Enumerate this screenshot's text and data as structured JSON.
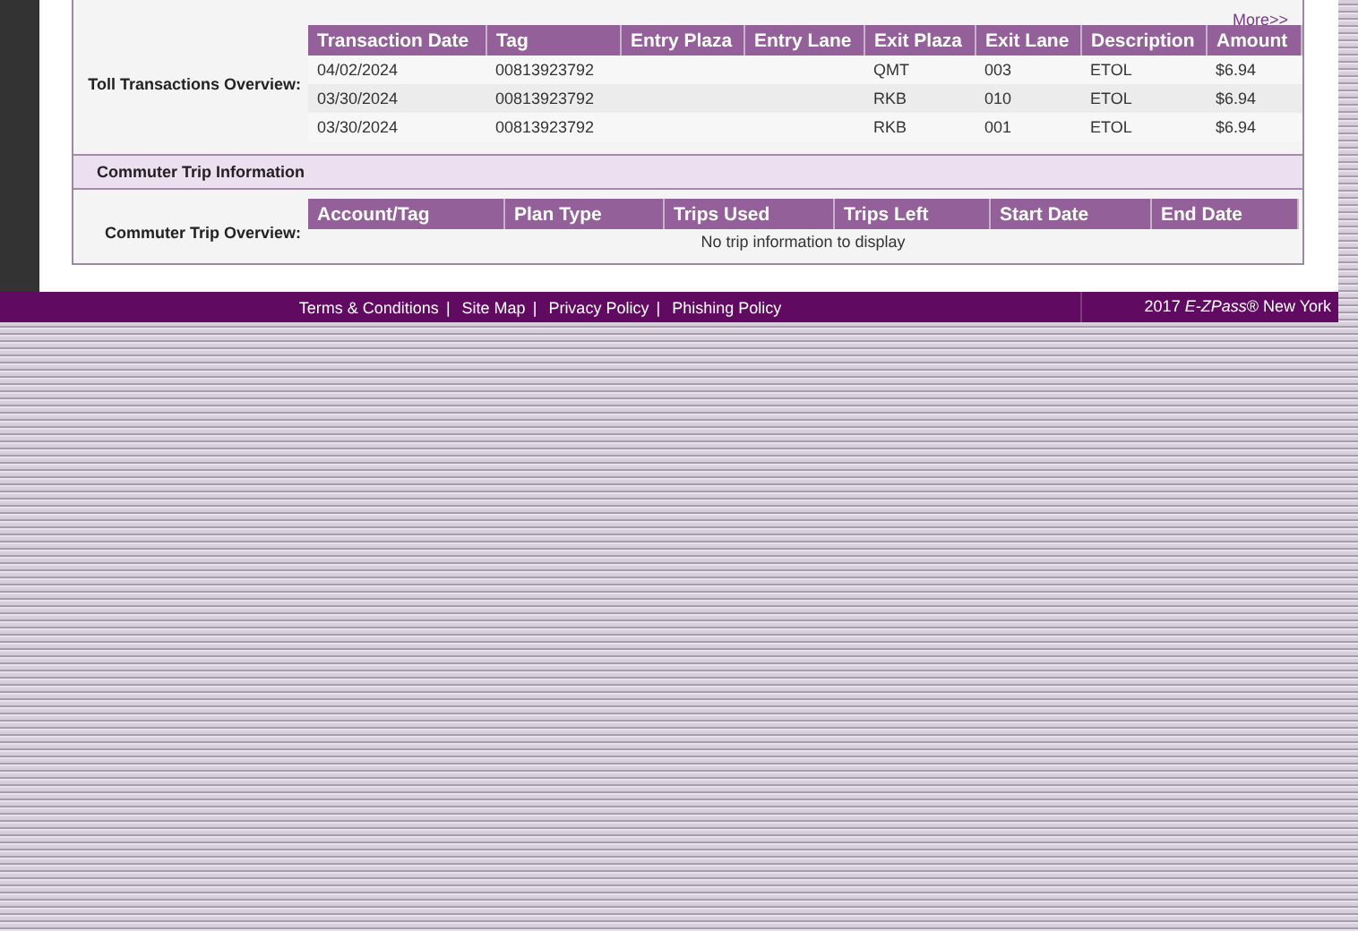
{
  "more_link": "More>>",
  "toll_transactions": {
    "label": "Toll Transactions Overview:",
    "columns": [
      "Transaction Date",
      "Tag",
      "Entry Plaza",
      "Entry Lane",
      "Exit Plaza",
      "Exit Lane",
      "Description",
      "Amount"
    ],
    "rows": [
      [
        "04/02/2024",
        "00813923792",
        "",
        "",
        "QMT",
        "003",
        "ETOL",
        "$6.94"
      ],
      [
        "03/30/2024",
        "00813923792",
        "",
        "",
        "RKB",
        "010",
        "ETOL",
        "$6.94"
      ],
      [
        "03/30/2024",
        "00813923792",
        "",
        "",
        "RKB",
        "001",
        "ETOL",
        "$6.94"
      ]
    ]
  },
  "commuter_section": {
    "title": "Commuter Trip Information",
    "label": "Commuter Trip Overview:",
    "columns": [
      "Account/Tag",
      "Plan Type",
      "Trips Used",
      "Trips Left",
      "Start Date",
      "End Date"
    ],
    "empty_message": "No trip information to display"
  },
  "footer": {
    "separators": [
      "|",
      "|",
      "|"
    ],
    "links": [
      "Terms & Conditions",
      "Site Map",
      "Privacy Policy",
      "Phishing Policy"
    ],
    "copyright": "2017 *E-ZPass*® New York"
  }
}
